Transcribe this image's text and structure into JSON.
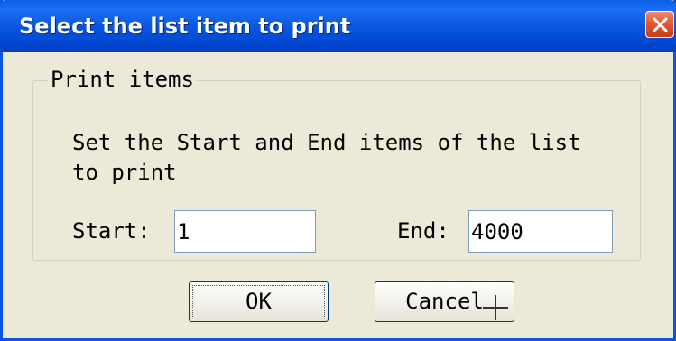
{
  "window": {
    "title": "Select the list item to print"
  },
  "titlebar": {
    "close_icon": "close-icon"
  },
  "group": {
    "legend": "Print items",
    "instructions": "Set the Start and End items of the list to print"
  },
  "start": {
    "label": "Start:",
    "value": "1"
  },
  "end": {
    "label": "End:",
    "value": "4000"
  },
  "buttons": {
    "ok_label": "OK",
    "cancel_label": "Cancel"
  },
  "colors": {
    "titlebar": "#0855dd",
    "window_bg": "#ece9d8",
    "close_button": "#e35a35"
  },
  "cursor": "crosshair-cursor-icon"
}
